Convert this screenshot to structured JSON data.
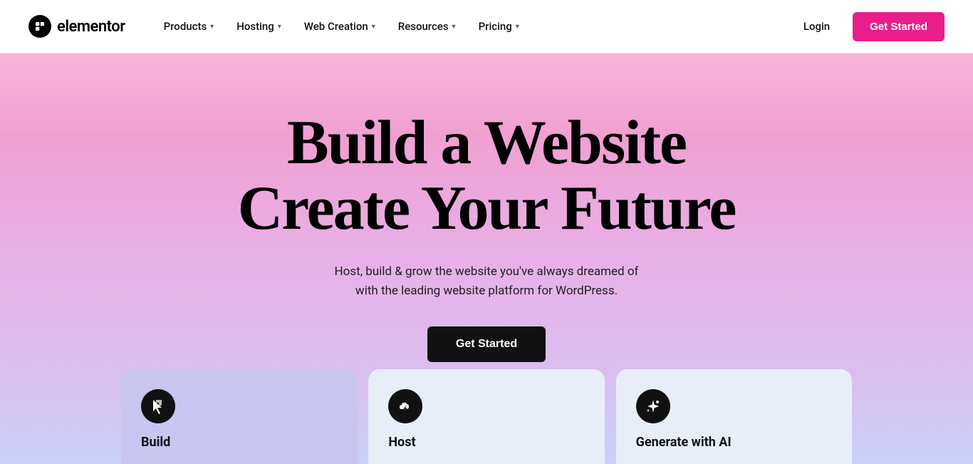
{
  "brand": {
    "name": "elementor",
    "logo_alt": "Elementor logo"
  },
  "navbar": {
    "menu_items": [
      {
        "label": "Products",
        "has_dropdown": true
      },
      {
        "label": "Hosting",
        "has_dropdown": true
      },
      {
        "label": "Web Creation",
        "has_dropdown": true
      },
      {
        "label": "Resources",
        "has_dropdown": true
      },
      {
        "label": "Pricing",
        "has_dropdown": true
      }
    ],
    "login_label": "Login",
    "get_started_label": "Get Started"
  },
  "hero": {
    "title_line1": "Build a Website",
    "title_line2": "Create Your Future",
    "subtitle_line1": "Host, build & grow the website you've always dreamed of",
    "subtitle_line2": "with the leading website platform for WordPress.",
    "cta_label": "Get Started"
  },
  "cards": [
    {
      "id": "build",
      "label": "Build",
      "icon": "build-icon"
    },
    {
      "id": "host",
      "label": "Host",
      "icon": "host-icon"
    },
    {
      "id": "ai",
      "label": "Generate with AI",
      "icon": "ai-icon"
    }
  ],
  "colors": {
    "pink_cta": "#e91e8c",
    "dark": "#111111",
    "hero_gradient_start": "#f8b4d9",
    "hero_gradient_end": "#c8d0f8"
  }
}
